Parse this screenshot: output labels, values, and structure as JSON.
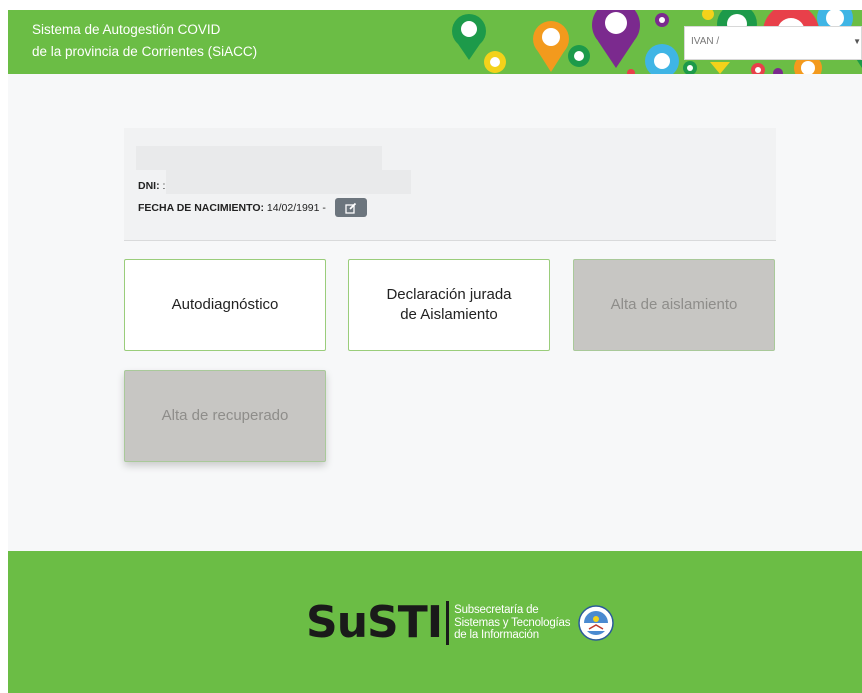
{
  "header": {
    "title_line1": "Sistema de Autogestión COVID",
    "title_line2": "de la provincia de Corrientes (SiACC)",
    "user_select_value": "IVAN /",
    "pin_icon": "map-pin-icon",
    "caret_icon": "chevron-down-icon"
  },
  "profile": {
    "dni_label": "DNI:",
    "dni_value": ":",
    "birth_label": "FECHA DE NACIMIENTO:",
    "birth_value": "14/02/1991 -",
    "edit_icon": "edit-icon"
  },
  "cards": {
    "autodiagnostico": "Autodiagnóstico",
    "declaracion_line1": "Declaración jurada",
    "declaracion_line2": "de Aislamiento",
    "alta_aislamiento": "Alta de aislamiento",
    "alta_recuperado": "Alta de recuperado"
  },
  "footer": {
    "logo_text": "SuSTI",
    "sub_line1": "Subsecretaría de",
    "sub_line2": "Sistemas y Tecnologías",
    "sub_line3": "de la Información",
    "seal_icon": "province-seal-icon"
  },
  "colors": {
    "brand_green": "#6bbd45",
    "card_border": "#9acd7b",
    "disabled_card": "#c7c6c3",
    "edit_button": "#6c757d"
  }
}
